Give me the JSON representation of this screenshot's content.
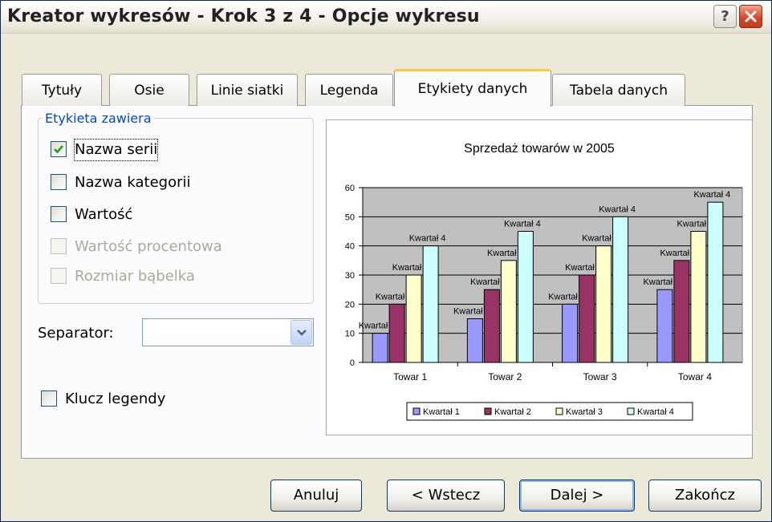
{
  "window": {
    "title": "Kreator wykresów - Krok 3 z 4 - Opcje wykresu",
    "help_label": "?"
  },
  "tabs": [
    {
      "label": "Tytuły"
    },
    {
      "label": "Osie"
    },
    {
      "label": "Linie siatki"
    },
    {
      "label": "Legenda"
    },
    {
      "label": "Etykiety danych",
      "active": true
    },
    {
      "label": "Tabela danych"
    }
  ],
  "label_group": {
    "title": "Etykieta zawiera",
    "items": [
      {
        "label": "Nazwa serii",
        "checked": true,
        "enabled": true
      },
      {
        "label": "Nazwa kategorii",
        "checked": false,
        "enabled": true
      },
      {
        "label": "Wartość",
        "checked": false,
        "enabled": true
      },
      {
        "label": "Wartość procentowa",
        "checked": false,
        "enabled": false
      },
      {
        "label": "Rozmiar bąbelka",
        "checked": false,
        "enabled": false
      }
    ]
  },
  "separator": {
    "label": "Separator:",
    "value": ""
  },
  "legend_key": {
    "label": "Klucz legendy",
    "checked": false
  },
  "buttons": {
    "cancel": "Anuluj",
    "back": "< Wstecz",
    "next": "Dalej >",
    "finish": "Zakończ"
  },
  "colors": {
    "accent_tab": "#ffc83c",
    "plot_area": "#c0c0c0"
  },
  "chart_data": {
    "type": "bar",
    "title": "Sprzedaż towarów w 2005",
    "categories": [
      "Towar 1",
      "Towar 2",
      "Towar 3",
      "Towar 4"
    ],
    "series": [
      {
        "name": "Kwartał 1",
        "color": "#9999ff",
        "values": [
          10,
          15,
          20,
          25
        ]
      },
      {
        "name": "Kwartał 2",
        "color": "#993366",
        "values": [
          20,
          25,
          30,
          35
        ]
      },
      {
        "name": "Kwartał 3",
        "color": "#ffffcc",
        "values": [
          30,
          35,
          40,
          45
        ]
      },
      {
        "name": "Kwartał 4",
        "color": "#ccffff",
        "values": [
          40,
          45,
          50,
          55
        ]
      }
    ],
    "ylim": [
      0,
      60
    ],
    "yticks": [
      0,
      10,
      20,
      30,
      40,
      50,
      60
    ],
    "data_labels": "series_name",
    "grid": true,
    "legend": "bottom"
  }
}
